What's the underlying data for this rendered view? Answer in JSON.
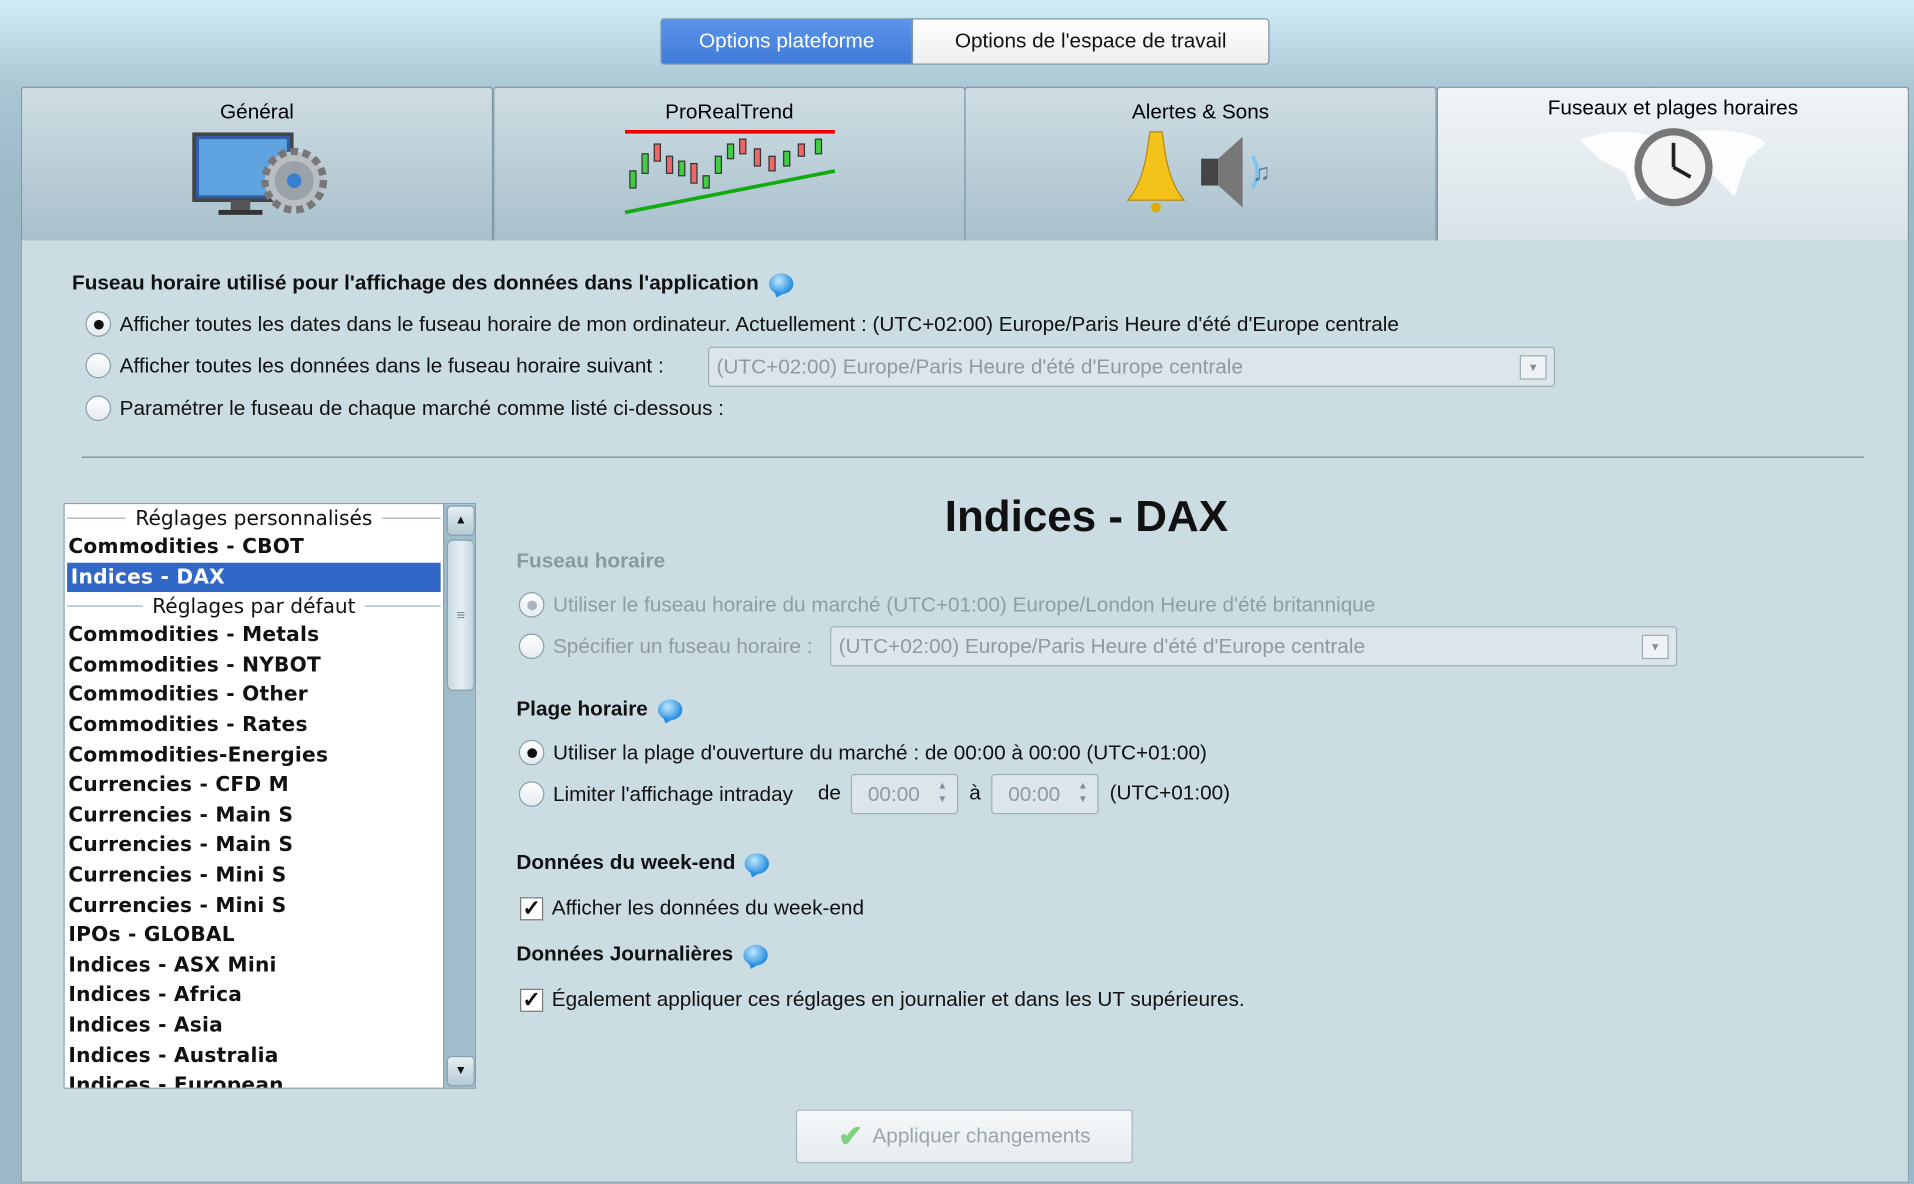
{
  "top_tabs": [
    {
      "label": "Options plateforme",
      "active": true
    },
    {
      "label": "Options de l'espace de travail",
      "active": false
    }
  ],
  "categories": [
    {
      "label": "Général",
      "icon": "monitor-gear-icon"
    },
    {
      "label": "ProRealTrend",
      "icon": "candlestick-trend-icon"
    },
    {
      "label": "Alertes & Sons",
      "icon": "bell-speaker-icon"
    },
    {
      "label": "Fuseaux et plages horaires",
      "icon": "world-clock-icon",
      "active": true
    }
  ],
  "global_tz": {
    "heading": "Fuseau horaire utilisé pour l'affichage des données dans l'application",
    "opt1": "Afficher toutes les dates dans le fuseau horaire de mon ordinateur. Actuellement : (UTC+02:00) Europe/Paris Heure d'été d'Europe centrale",
    "opt2": "Afficher toutes les données dans le fuseau horaire suivant :",
    "opt2_value": "(UTC+02:00) Europe/Paris Heure d'été d'Europe centrale",
    "opt3": "Paramétrer le fuseau de chaque marché comme listé ci-dessous :",
    "selected": 1
  },
  "market_list": {
    "group_custom": "Réglages personnalisés",
    "custom_items": [
      "Commodities - CBOT",
      "Indices - DAX"
    ],
    "selected": "Indices - DAX",
    "group_default": "Réglages par défaut",
    "default_items": [
      "Commodities - Metals",
      "Commodities - NYBOT",
      "Commodities - Other",
      "Commodities - Rates",
      "Commodities-Energies",
      "Currencies - CFD M",
      "Currencies - Main S",
      "Currencies - Main S",
      "Currencies - Mini S",
      "Currencies - Mini S",
      "IPOs - GLOBAL",
      "Indices - ASX Mini",
      "Indices - Africa",
      "Indices - Asia",
      "Indices - Australia",
      "Indices - European"
    ]
  },
  "detail": {
    "title": "Indices - DAX",
    "tz_heading": "Fuseau horaire",
    "tz_opt1": "Utiliser le fuseau horaire du marché (UTC+01:00) Europe/London Heure d'été britannique",
    "tz_opt2": "Spécifier un fuseau horaire :",
    "tz_opt2_value": "(UTC+02:00) Europe/Paris Heure d'été d'Europe centrale",
    "range_heading": "Plage horaire",
    "range_opt1": "Utiliser la plage d'ouverture du marché : de 00:00 à 00:00  (UTC+01:00)",
    "range_opt2": "Limiter l'affichage intraday",
    "range_from_label": "de",
    "range_from": "00:00",
    "range_to_label": "à",
    "range_to": "00:00",
    "range_tz": "(UTC+01:00)",
    "weekend_heading": "Données du week-end",
    "weekend_check": "Afficher les données du week-end",
    "weekend_checked": true,
    "daily_heading": "Données Journalières",
    "daily_check": "Également appliquer ces réglages en journalier et dans les UT supérieures.",
    "daily_checked": true
  },
  "apply_label": "Appliquer changements",
  "colors": {
    "accent": "#4a86e0",
    "selection": "#3167c6"
  }
}
